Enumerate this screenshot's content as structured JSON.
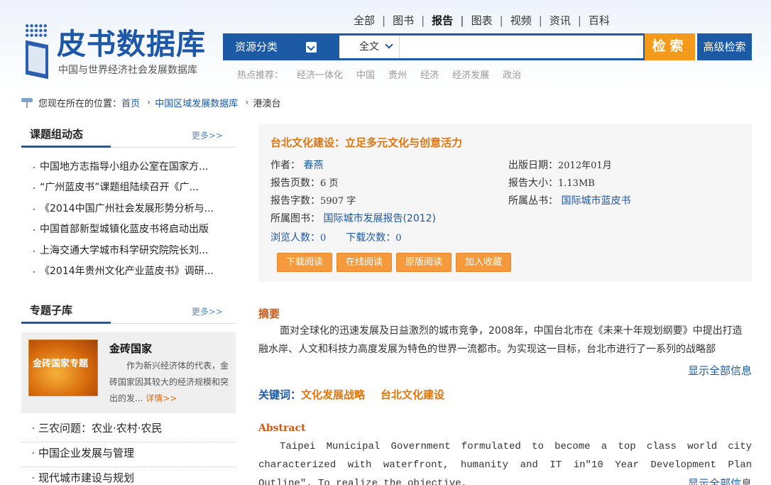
{
  "logo": {
    "title": "皮书数据库",
    "subtitle": "中国与世界经济社会发展数据库"
  },
  "topnav": [
    {
      "label": "全部",
      "active": false
    },
    {
      "label": "图书",
      "active": false
    },
    {
      "label": "报告",
      "active": true
    },
    {
      "label": "图表",
      "active": false
    },
    {
      "label": "视频",
      "active": false
    },
    {
      "label": "资讯",
      "active": false
    },
    {
      "label": "百科",
      "active": false
    }
  ],
  "search": {
    "category_label": "资源分类",
    "scope_label": "全文",
    "placeholder": "",
    "button_label": "检索",
    "advanced_label": "高级检索"
  },
  "hot": {
    "label": "热点推荐：",
    "items": [
      "经济一体化",
      "中国",
      "贵州",
      "经济",
      "经济发展",
      "政治"
    ]
  },
  "breadcrumb": {
    "prefix": "您现在所在的位置：",
    "items": [
      "首页",
      "中国区域发展数据库",
      "港澳台"
    ]
  },
  "news_panel": {
    "title": "课题组动态",
    "more": "更多>>",
    "items": [
      "中国地方志指导小组办公室在国家方...",
      "“广州蓝皮书”课题组陆续召开《广...",
      "《2014中国广州社会发展形势分析与...",
      "中国首部新型城镇化蓝皮书将启动出版",
      "上海交通大学城市科学研究院院长刘...",
      "《2014年贵州文化产业蓝皮书》调研..."
    ]
  },
  "topic_panel": {
    "title": "专题子库",
    "more": "更多>>",
    "feature": {
      "image_text": "金砖国家专题",
      "title": "金砖国家",
      "desc": "作为新兴经济体的代表，金砖国家因其较大的经济规模和突出的发...",
      "link": "详情>>"
    },
    "items": [
      "三农问题：农业·农村·农民",
      "中国企业发展与管理",
      "现代城市建设与规划"
    ]
  },
  "report": {
    "title": "台北文化建设：立足多元文化与创意活力",
    "author_label": "作者：",
    "author": "春燕",
    "pages_label": "报告页数：",
    "pages": "6 页",
    "words_label": "报告字数：",
    "words": "5907 字",
    "book_label": "所属图书：",
    "book": "国际城市发展报告(2012)",
    "views_label": "浏览人数：",
    "views": "0",
    "downloads_label": "下载次数：",
    "downloads": "0",
    "date_label": "出版日期：",
    "date": "2012年01月",
    "size_label": "报告大小：",
    "size": "1.13MB",
    "series_label": "所属丛书：",
    "series": "国际城市蓝皮书",
    "buttons": [
      "下载阅读",
      "在线阅读",
      "原版阅读",
      "加入收藏"
    ]
  },
  "abstract": {
    "label": "摘要",
    "text": "面对全球化的迅速发展及日益激烈的城市竞争，2008年，中国台北市在《未来十年规划纲要》中提出打造融水岸、人文和科技力高度发展为特色的世界一流都市。为实现这一目标，台北市进行了一系列的战略部",
    "show_all": "显示全部信息"
  },
  "keywords": {
    "label": "关键词：",
    "items": [
      "文化发展战略",
      "台北文化建设"
    ]
  },
  "abstract_en": {
    "label": "Abstract",
    "text": "Taipei Municipal Government formulated to become a top class world city characterized with waterfront, humanity and IT in\"10 Year Development Plan Outline\". To realize the objective,",
    "show_all": "显示全部信息"
  },
  "colors": {
    "brand_blue": "#1c5aa6",
    "accent_orange": "#f39a1b",
    "keyword_orange": "#e0750e"
  }
}
